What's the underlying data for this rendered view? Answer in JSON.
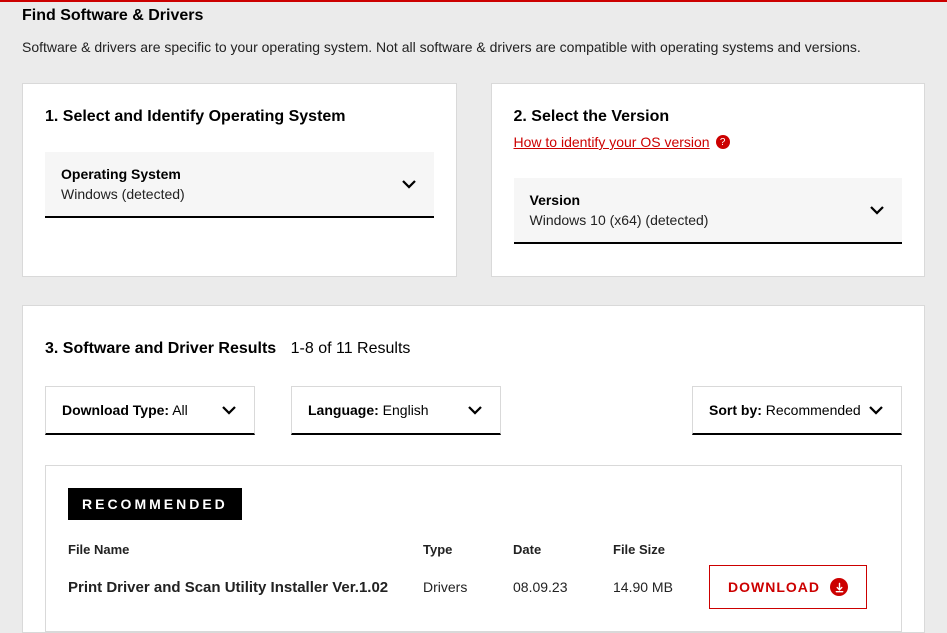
{
  "page_title": "Find Software & Drivers",
  "subtitle": "Software & drivers are specific to your operating system. Not all software & drivers are compatible with operating systems and versions.",
  "step1": {
    "title": "1. Select and Identify Operating System",
    "select_label": "Operating System",
    "select_value": "Windows (detected)"
  },
  "step2": {
    "title": "2. Select the Version",
    "help_link": "How to identify your OS version",
    "select_label": "Version",
    "select_value": "Windows 10 (x64) (detected)"
  },
  "results": {
    "title": "3. Software and Driver Results",
    "count_text": "1-8  of  11 Results",
    "filters": {
      "download_type_label": "Download Type:",
      "download_type_value": " All",
      "language_label": "Language:",
      "language_value": " English",
      "sort_label": "Sort by:",
      "sort_value": " Recommended"
    },
    "recommended_badge": "RECOMMENDED",
    "headers": {
      "name": "File Name",
      "type": "Type",
      "date": "Date",
      "size": "File Size"
    },
    "row": {
      "name": "Print Driver and Scan Utility Installer Ver.1.02",
      "type": "Drivers",
      "date": "08.09.23",
      "size": "14.90 MB"
    },
    "download_label": "DOWNLOAD"
  }
}
